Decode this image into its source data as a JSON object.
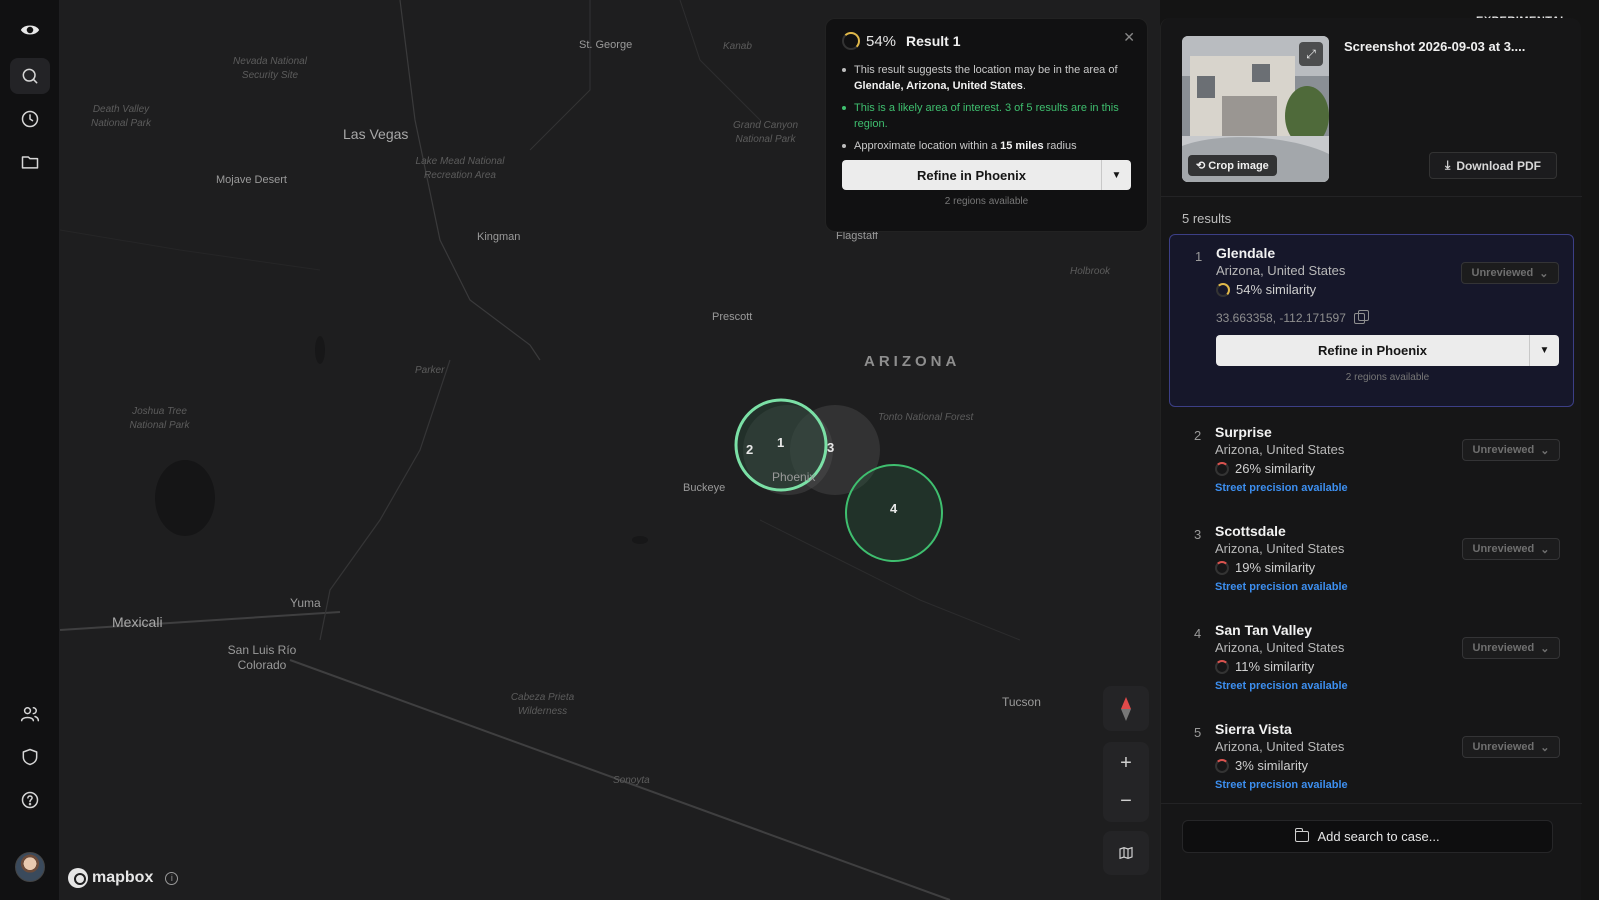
{
  "sidebar": {
    "logo": "eye-logo-icon",
    "items": [
      {
        "icon": "search-icon"
      },
      {
        "icon": "history-icon"
      },
      {
        "icon": "folder-icon"
      }
    ],
    "bottom_items": [
      {
        "icon": "users-icon"
      },
      {
        "icon": "shield-icon"
      },
      {
        "icon": "help-icon"
      }
    ]
  },
  "map": {
    "labels": {
      "las_vegas": "Las Vegas",
      "st_george": "St. George",
      "kanab": "Kanab",
      "mojave": "Mojave Desert",
      "kingman": "Kingman",
      "flagstaff": "Flagstaff",
      "prescott": "Prescott",
      "arizona": "ARIZONA",
      "buckeye": "Buckeye",
      "phoenix": "Phoenix",
      "parker": "Parker",
      "yuma": "Yuma",
      "mexicali": "Mexicali",
      "san_luis": "San Luis Río Colorado",
      "tucson": "Tucson",
      "sonoyta": "Sonoyta",
      "holbrook": "Holbrook",
      "nevada_park": "Nevada National Security Site",
      "death_valley": "Death Valley National Park",
      "lake_mead": "Lake Mead National Recreation Area",
      "grand_canyon": "Grand Canyon National Park",
      "joshua_tree": "Joshua Tree National Park",
      "tonto": "Tonto National Forest",
      "cabeza": "Cabeza Prieta Wilderness"
    },
    "clusters": [
      "1",
      "2",
      "3",
      "4"
    ],
    "attribution": "mapbox"
  },
  "popup": {
    "percent": "54%",
    "title": "Result 1",
    "bullet1_pre": "This result suggests the location may be in the area of ",
    "bullet1_bold": "Glendale, Arizona, United States",
    "bullet1_post": ".",
    "bullet2": "This is a likely area of interest. 3 of 5 results are in this region.",
    "bullet3_pre": "Approximate location within a ",
    "bullet3_bold": "15 miles",
    "bullet3_post": " radius",
    "refine_label": "Refine in Phoenix",
    "regions": "2 regions available"
  },
  "panel": {
    "badge": "EXPERIMENTAL",
    "screenshot_title": "Screenshot 2026-09-03 at 3....",
    "crop_label": "Crop image",
    "download_label": "Download PDF",
    "results_count": "5 results",
    "add_case_label": "Add search to case...",
    "results": [
      {
        "num": "1",
        "name": "Glendale",
        "region": "Arizona, United States",
        "similarity": "54% similarity",
        "coords": "33.663358, -112.171597",
        "status": "Unreviewed",
        "refine_label": "Refine in Phoenix",
        "regions": "2 regions available"
      },
      {
        "num": "2",
        "name": "Surprise",
        "region": "Arizona, United States",
        "similarity": "26% similarity",
        "street": "Street precision available",
        "status": "Unreviewed"
      },
      {
        "num": "3",
        "name": "Scottsdale",
        "region": "Arizona, United States",
        "similarity": "19% similarity",
        "street": "Street precision available",
        "status": "Unreviewed"
      },
      {
        "num": "4",
        "name": "San Tan Valley",
        "region": "Arizona, United States",
        "similarity": "11% similarity",
        "street": "Street precision available",
        "status": "Unreviewed"
      },
      {
        "num": "5",
        "name": "Sierra Vista",
        "region": "Arizona, United States",
        "similarity": "3% similarity",
        "street": "Street precision available",
        "status": "Unreviewed"
      }
    ]
  },
  "colors": {
    "accent_green": "#3fbf6f",
    "link_blue": "#3d8ff0",
    "selected_border": "#3c3f86",
    "badge_dot": "#f0b030"
  }
}
